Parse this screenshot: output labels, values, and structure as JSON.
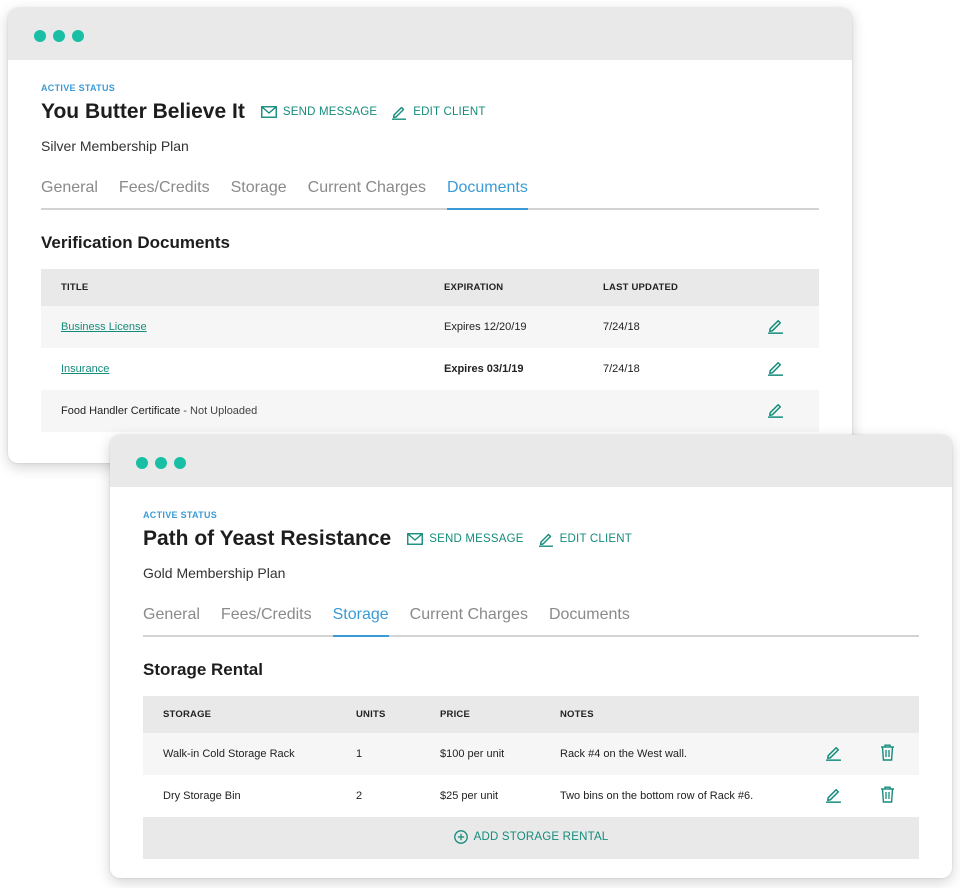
{
  "colors": {
    "accent": "#3a9bd6",
    "teal": "#148c7c",
    "dot": "#18bfa5",
    "danger": "#e0344f"
  },
  "windows": [
    {
      "status": "ACTIVE STATUS",
      "client_name": "You Butter Believe It",
      "send_message": "SEND MESSAGE",
      "edit_client": "EDIT CLIENT",
      "plan": "Silver Membership Plan",
      "tabs": [
        "General",
        "Fees/Credits",
        "Storage",
        "Current Charges",
        "Documents"
      ],
      "active_tab": "Documents",
      "section_title": "Verification Documents",
      "columns": [
        "TITLE",
        "EXPIRATION",
        "LAST UPDATED"
      ],
      "rows": [
        {
          "title": "Business License",
          "expiration": "Expires 12/20/19",
          "updated": "7/24/18"
        },
        {
          "title": "Insurance",
          "expiration": "Expires 03/1/19",
          "updated": "7/24/18"
        },
        {
          "title": "Food Handler Certificate",
          "note": " - Not Uploaded",
          "expiration": "",
          "updated": ""
        }
      ]
    },
    {
      "status": "ACTIVE STATUS",
      "client_name": "Path of Yeast Resistance",
      "send_message": "SEND MESSAGE",
      "edit_client": "EDIT CLIENT",
      "plan": "Gold Membership Plan",
      "tabs": [
        "General",
        "Fees/Credits",
        "Storage",
        "Current Charges",
        "Documents"
      ],
      "active_tab": "Storage",
      "section_title": "Storage Rental",
      "columns": [
        "STORAGE",
        "UNITS",
        "PRICE",
        "NOTES"
      ],
      "rows": [
        {
          "storage": "Walk-in Cold Storage Rack",
          "units": "1",
          "price": "$100 per unit",
          "notes": "Rack #4 on the West wall."
        },
        {
          "storage": "Dry Storage Bin",
          "units": "2",
          "price": "$25 per unit",
          "notes": "Two bins on the bottom row of Rack #6."
        }
      ],
      "add_label": "ADD STORAGE RENTAL"
    }
  ]
}
